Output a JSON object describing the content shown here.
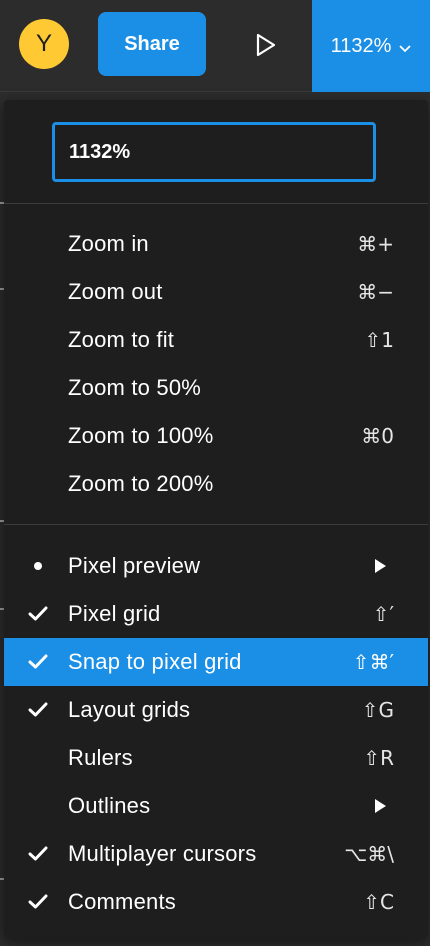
{
  "topbar": {
    "avatar_initial": "Y",
    "share_label": "Share",
    "zoom_label": "1132%"
  },
  "zoom_menu": {
    "input_value": "1132%",
    "zoom_items": [
      {
        "label": "Zoom in",
        "shortcut": "⌘+"
      },
      {
        "label": "Zoom out",
        "shortcut": "⌘−"
      },
      {
        "label": "Zoom to fit",
        "shortcut": "⇧1"
      },
      {
        "label": "Zoom to 50%",
        "shortcut": ""
      },
      {
        "label": "Zoom to 100%",
        "shortcut": "⌘0"
      },
      {
        "label": "Zoom to 200%",
        "shortcut": ""
      }
    ],
    "view_items": [
      {
        "label": "Pixel preview",
        "indicator": "bullet",
        "shortcut": "",
        "submenu": true
      },
      {
        "label": "Pixel grid",
        "indicator": "check",
        "shortcut": "⇧′"
      },
      {
        "label": "Snap to pixel grid",
        "indicator": "check",
        "shortcut": "⇧⌘′",
        "highlighted": true
      },
      {
        "label": "Layout grids",
        "indicator": "check",
        "shortcut": "⇧G"
      },
      {
        "label": "Rulers",
        "indicator": "none",
        "shortcut": "⇧R"
      },
      {
        "label": "Outlines",
        "indicator": "none",
        "shortcut": "",
        "submenu": true
      },
      {
        "label": "Multiplayer cursors",
        "indicator": "check",
        "shortcut": "⌥⌘\\"
      },
      {
        "label": "Comments",
        "indicator": "check",
        "shortcut": "⇧C"
      }
    ]
  },
  "colors": {
    "accent": "#1b8fe5",
    "avatar": "#ffc933",
    "menu_bg": "#1e1e1e",
    "toolbar_bg": "#2c2c2c"
  },
  "icons": {
    "play": "play-icon",
    "chevron": "chevron-down-icon",
    "check": "checkmark-icon",
    "submenu": "submenu-arrow-icon",
    "bullet": "bullet-icon"
  }
}
